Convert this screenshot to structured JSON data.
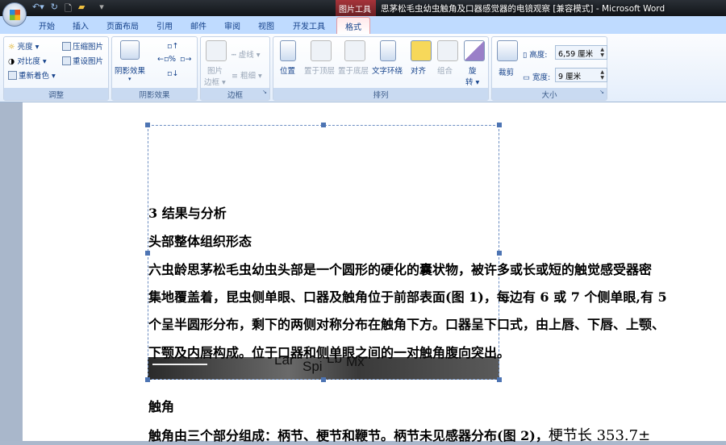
{
  "window": {
    "title": "思茅松毛虫幼虫触角及口器感觉器的电镜观察 [兼容模式] - Microsoft Word",
    "context_tab": "图片工具"
  },
  "tabs": [
    "开始",
    "插入",
    "页面布局",
    "引用",
    "邮件",
    "审阅",
    "视图",
    "开发工具",
    "格式"
  ],
  "groups": {
    "adjust": {
      "label": "调整",
      "items": [
        "亮度",
        "对比度",
        "重新着色",
        "压缩图片",
        "重设图片"
      ]
    },
    "shadow": {
      "label": "阴影效果",
      "button": "阴影效果"
    },
    "border": {
      "label": "边框",
      "picture_border": [
        "图片",
        "边框"
      ],
      "dash": "虚线",
      "weight": "粗细"
    },
    "arrange": {
      "label": "排列",
      "items": [
        "位置",
        "置于顶层",
        "置于底层",
        "文字环绕",
        "对齐",
        "组合"
      ],
      "rotate": [
        "旋",
        "转"
      ]
    },
    "size": {
      "label": "大小",
      "crop": "裁剪",
      "height_label": "高度:",
      "height_value": "6,59 厘米",
      "width_label": "宽度:",
      "width_value": "9 厘米"
    }
  },
  "document": {
    "heading": "3 结果与分析",
    "subheading": "头部整体组织形态",
    "para": [
      "六虫龄思茅松毛虫幼虫头部是一个圆形的硬化的囊状物，被许多或长或短的触觉感受器密",
      "集地覆盖着，昆虫侧单眼、口器及触角位于前部表面(图 1)，每边有 6 或 7 个侧单眼,有 5",
      "个呈半圆形分布，剩下的两侧对称分布在触角下方。口器呈下口式，由上唇、下唇、上颚、",
      "下颚及内唇构成。位于口器和侧单眼之间的一对触角腹向突出。"
    ],
    "photo_labels": [
      "Lar",
      "Spi",
      "Lb",
      "Mx"
    ],
    "heading2": "触角",
    "para2": "触角由三个部分组成：柄节、梗节和鞭节。柄节未见感器分布(图 2)，",
    "para2_tail": "梗节长  353.7±"
  }
}
